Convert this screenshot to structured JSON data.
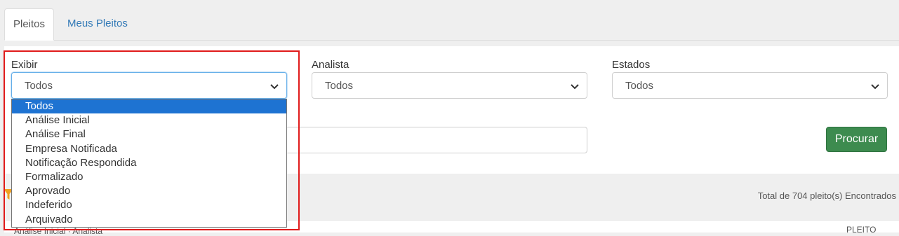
{
  "tabs": [
    {
      "label": "Pleitos",
      "active": true
    },
    {
      "label": "Meus Pleitos",
      "active": false
    }
  ],
  "filters": {
    "exibir": {
      "label": "Exibir",
      "value": "Todos"
    },
    "analista": {
      "label": "Analista",
      "value": "Todos"
    },
    "estados": {
      "label": "Estados",
      "value": "Todos"
    }
  },
  "dropdown": {
    "options": [
      "Todos",
      "Análise Inicial",
      "Análise Final",
      "Empresa Notificada",
      "Notificação Respondida",
      "Formalizado",
      "Aprovado",
      "Indeferido",
      "Arquivado"
    ],
    "selected": "Todos"
  },
  "search": {
    "button_label": "Procurar"
  },
  "results": {
    "total_text": "Total de 704 pleito(s) Encontrados"
  },
  "table": {
    "col_left": "Análise Inicial · Analista",
    "col_right": "PLEITO"
  },
  "colors": {
    "accent": "#337ab7",
    "button": "#3d8b4f",
    "highlight": "#e01a1a",
    "selected_option": "#1e73d2"
  },
  "icons": {
    "funnel": "filter-icon",
    "chevron": "chevron-down-icon"
  }
}
